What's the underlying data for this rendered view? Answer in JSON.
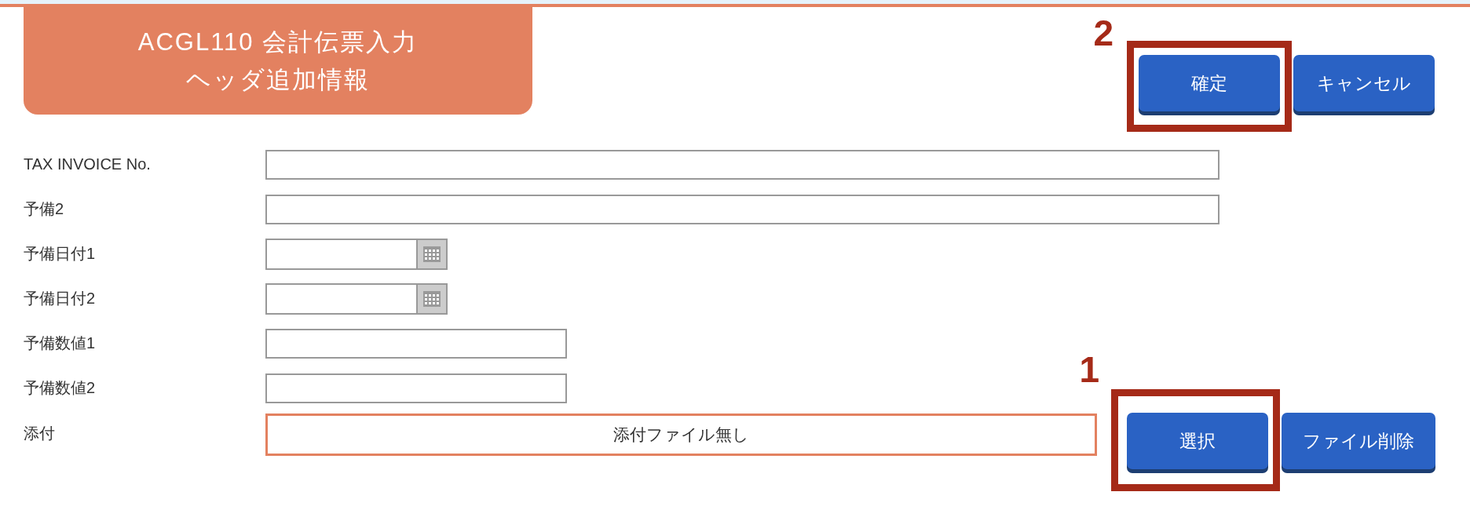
{
  "header": {
    "title_lines": [
      "ACGL110 会計伝票入力",
      "ヘッダ追加情報"
    ],
    "buttons": [
      {
        "label": "確定",
        "callout": "2"
      },
      {
        "label": "キャンセル"
      }
    ]
  },
  "fields": [
    {
      "label": "TAX INVOICE No.",
      "kind": "text"
    },
    {
      "label": "予備2",
      "kind": "text"
    },
    {
      "label": "予備日付1",
      "kind": "date"
    },
    {
      "label": "予備日付2",
      "kind": "date"
    },
    {
      "label": "予備数値1",
      "kind": "number"
    },
    {
      "label": "予備数値2",
      "kind": "number"
    },
    {
      "label": "添付",
      "kind": "file",
      "value": "添付ファイル無し",
      "buttons": [
        {
          "label": "選択",
          "callout": "1"
        },
        {
          "label": "ファイル削除"
        }
      ]
    }
  ]
}
